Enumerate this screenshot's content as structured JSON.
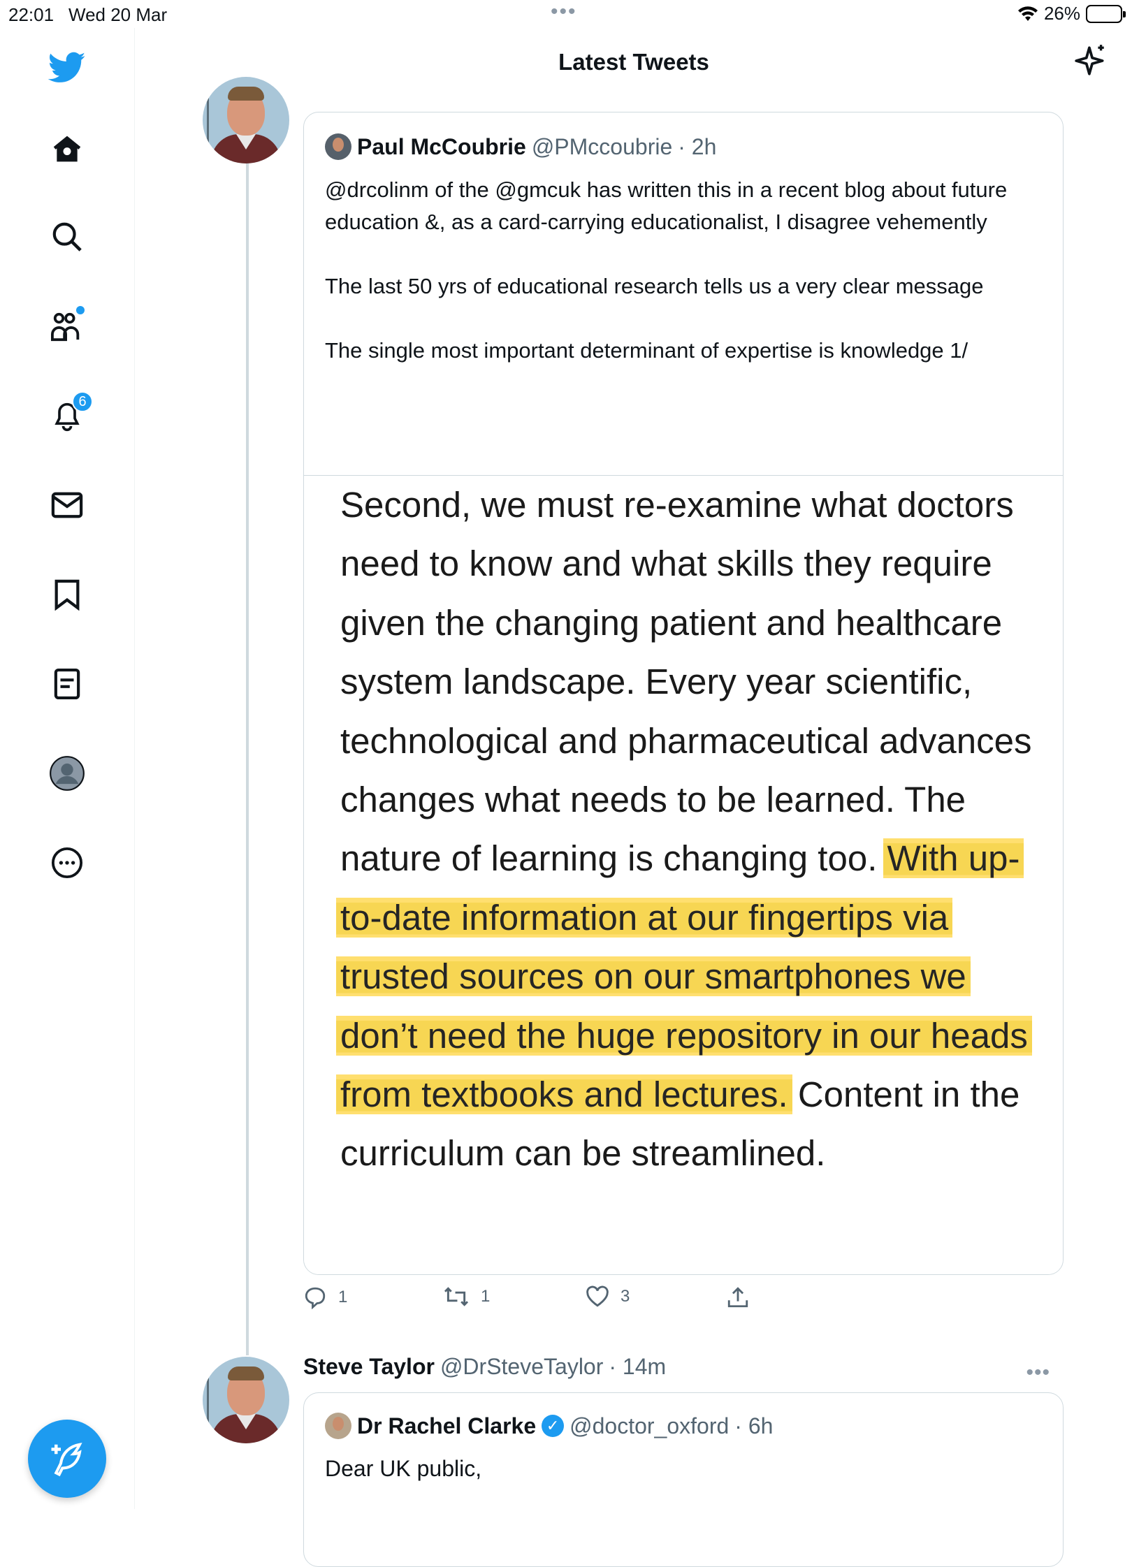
{
  "status_bar": {
    "time": "22:01",
    "date": "Wed 20 Mar",
    "battery": "26%",
    "battery_level": 0.26
  },
  "header": {
    "title": "Latest Tweets"
  },
  "sidebar": {
    "items": [
      {
        "name": "home",
        "icon": "home-icon"
      },
      {
        "name": "search",
        "icon": "search-icon"
      },
      {
        "name": "communities",
        "icon": "communities-icon"
      },
      {
        "name": "notifications",
        "icon": "bell-icon",
        "badge": "6"
      },
      {
        "name": "messages",
        "icon": "mail-icon"
      },
      {
        "name": "bookmarks",
        "icon": "bookmark-icon"
      },
      {
        "name": "lists",
        "icon": "list-icon"
      },
      {
        "name": "profile",
        "icon": "profile-icon"
      },
      {
        "name": "more",
        "icon": "more-icon"
      }
    ],
    "compose": "compose-icon"
  },
  "tweet1": {
    "quote": {
      "name": "Paul McCoubrie",
      "handle": "@PMccoubrie",
      "time": "· 2h",
      "paragraphs": [
        "@drcolinm of the @gmcuk has written this in a recent blog about future education &, as a card-carrying educationalist, I disagree vehemently",
        "The last 50 yrs of educational research tells us a very clear message",
        "The single most important determinant of expertise is knowledge 1/"
      ],
      "image_text_before": "Second, we must re-examine what doctors need to know and what skills they require given the changing patient and healthcare system landscape. Every year scientific, technological and pharmaceutical advances changes what needs to be learned. The nature of learning is changing too.",
      "image_text_highlight": "With up-to-date information at our fingertips via trusted sources on our smartphones we don’t need the huge repository in our heads from textbooks and lectures.",
      "image_text_after": "Content in the curriculum can be streamlined."
    },
    "actions": {
      "replies": "1",
      "retweets": "1",
      "likes": "3"
    }
  },
  "tweet2": {
    "name": "Steve Taylor",
    "handle": "@DrSteveTaylor",
    "time": "· 14m",
    "quote": {
      "name": "Dr Rachel Clarke",
      "handle": "@doctor_oxford",
      "time": "· 6h",
      "text": "Dear UK public,"
    }
  },
  "colors": {
    "accent": "#1d9bf0",
    "highlight": "#f7d44a",
    "text": "#0f1419",
    "muted": "#536471"
  }
}
